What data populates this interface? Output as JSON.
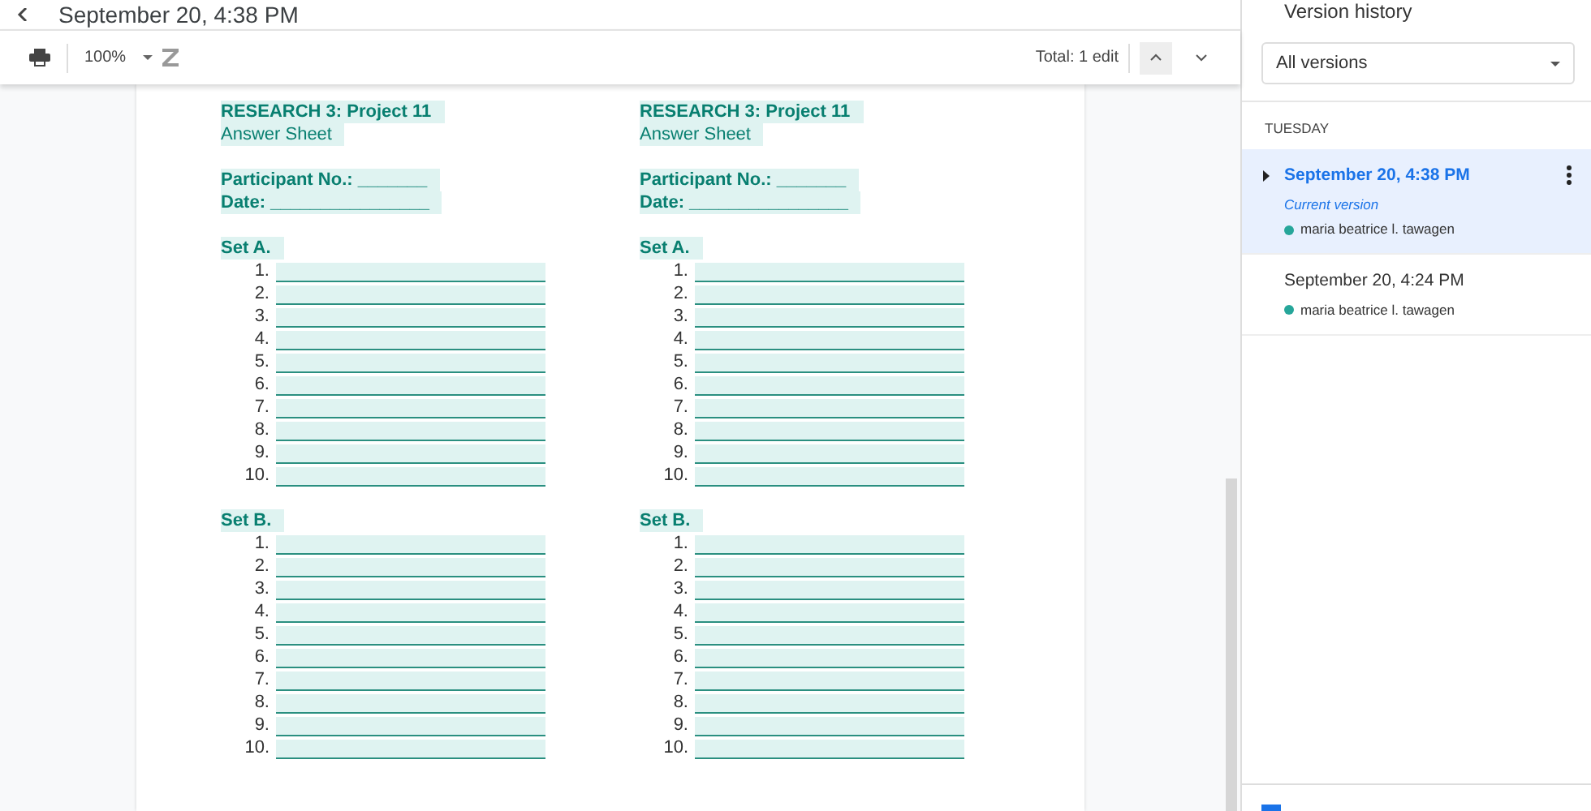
{
  "header": {
    "title": "September 20, 4:38 PM"
  },
  "toolbar": {
    "zoom": "100%",
    "total": "Total: 1 edit"
  },
  "document": {
    "columns": [
      {
        "title": "RESEARCH 3: Project 11",
        "subtitle": "Answer Sheet",
        "participant": "Participant No.: _______",
        "date": "Date: ________________",
        "sets": [
          {
            "label": "Set A.",
            "items": [
              "1.",
              "2.",
              "3.",
              "4.",
              "5.",
              "6.",
              "7.",
              "8.",
              "9.",
              "10."
            ]
          },
          {
            "label": "Set B.",
            "items": [
              "1.",
              "2.",
              "3.",
              "4.",
              "5.",
              "6.",
              "7.",
              "8.",
              "9.",
              "10."
            ]
          }
        ]
      },
      {
        "title": "RESEARCH 3: Project 11",
        "subtitle": "Answer Sheet",
        "participant": "Participant No.: _______",
        "date": "Date: ________________",
        "sets": [
          {
            "label": "Set A.",
            "items": [
              "1.",
              "2.",
              "3.",
              "4.",
              "5.",
              "6.",
              "7.",
              "8.",
              "9.",
              "10."
            ]
          },
          {
            "label": "Set B.",
            "items": [
              "1.",
              "2.",
              "3.",
              "4.",
              "5.",
              "6.",
              "7.",
              "8.",
              "9.",
              "10."
            ]
          }
        ]
      }
    ]
  },
  "sidebar": {
    "title": "Version history",
    "filter": "All versions",
    "day": "TUESDAY",
    "versions": [
      {
        "time": "September 20, 4:38 PM",
        "note": "Current version",
        "author": "maria beatrice l. tawagen",
        "color": "#26a69a",
        "selected": true,
        "expander": true
      },
      {
        "time": "September 20, 4:24 PM",
        "author": "maria beatrice l. tawagen",
        "color": "#26a69a",
        "selected": false,
        "expander": false
      }
    ]
  }
}
